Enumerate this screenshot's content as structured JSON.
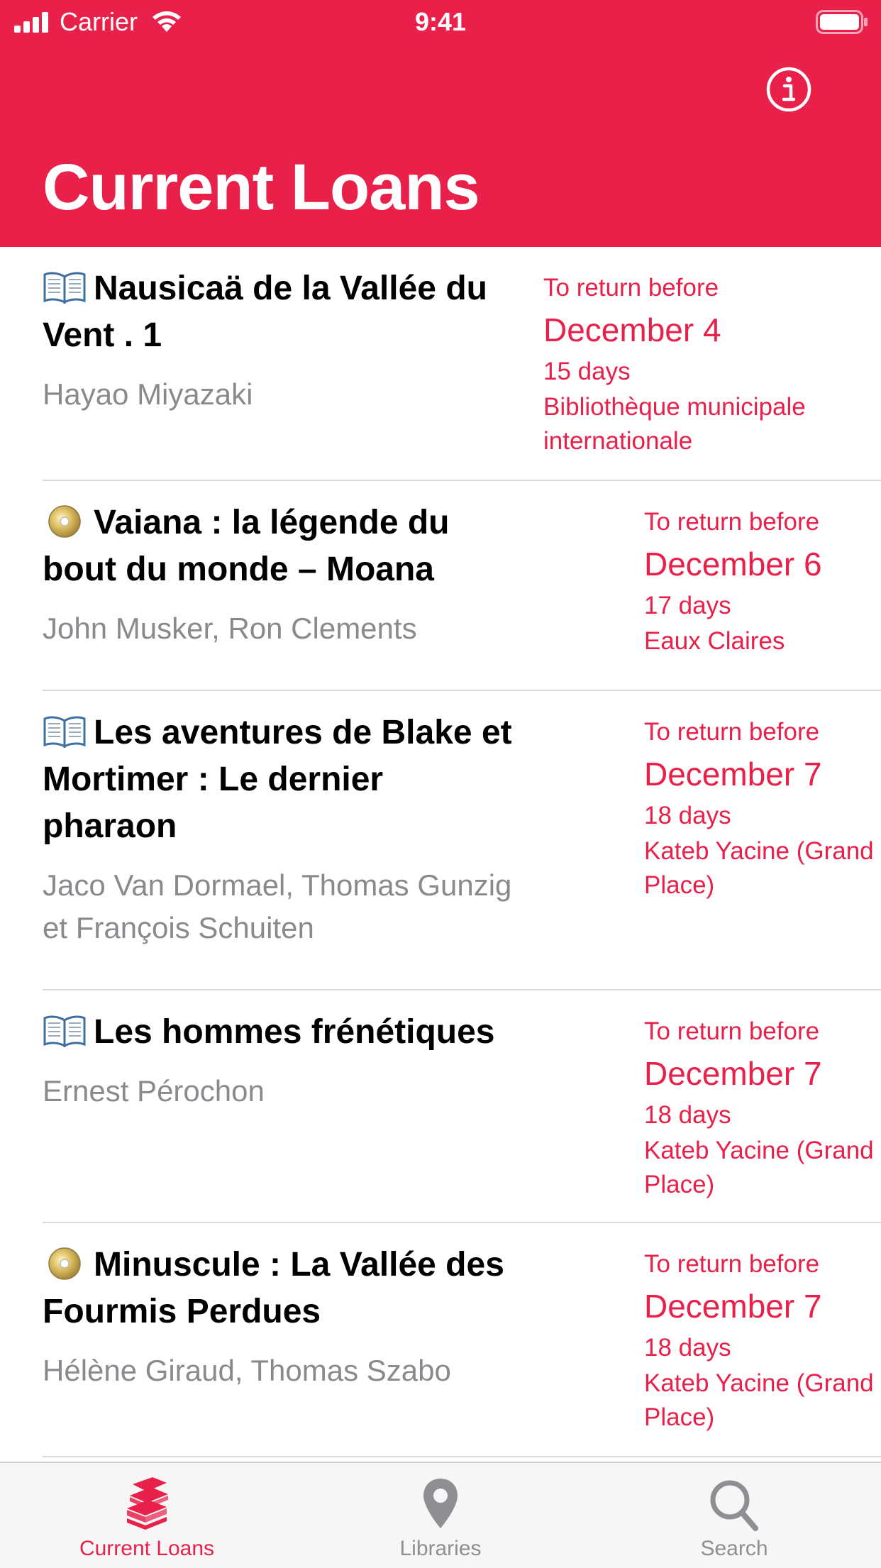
{
  "status_bar": {
    "carrier": "Carrier",
    "time": "9:41"
  },
  "header": {
    "title": "Current Loans",
    "info_icon": "info-circle-icon",
    "background_color": "#e8204a"
  },
  "loans": [
    {
      "media_icon": "book-icon",
      "title": "Nausicaä de la Vallée du Vent . 1",
      "author": "Hayao Miyazaki",
      "due_label": "To return before",
      "due_date": "December 4",
      "days_left": "15 days",
      "library": "Bibliothèque municipale internationale"
    },
    {
      "media_icon": "dvd-icon",
      "title": "Vaiana : la légende du bout du monde – Moana",
      "author": "John Musker, Ron Clements",
      "due_label": "To return before",
      "due_date": "December 6",
      "days_left": "17 days",
      "library": "Eaux Claires"
    },
    {
      "media_icon": "book-icon",
      "title": "Les aventures de Blake et Mortimer : Le dernier pharaon",
      "author": "Jaco Van Dormael, Thomas Gunzig et François Schuiten",
      "due_label": "To return before",
      "due_date": "December 7",
      "days_left": "18 days",
      "library": "Kateb Yacine (Grand Place)"
    },
    {
      "media_icon": "book-icon",
      "title": "Les hommes frénétiques",
      "author": "Ernest Pérochon",
      "due_label": "To return before",
      "due_date": "December 7",
      "days_left": "18 days",
      "library": "Kateb Yacine (Grand Place)"
    },
    {
      "media_icon": "dvd-icon",
      "title": "Minuscule : La Vallée des Fourmis Perdues",
      "author": "Hélène Giraud, Thomas Szabo",
      "due_label": "To return before",
      "due_date": "December 7",
      "days_left": "18 days",
      "library": "Kateb Yacine (Grand Place)"
    }
  ],
  "tab_bar": {
    "tabs": [
      {
        "label": "Current Loans",
        "icon": "books-stack-icon",
        "active": true
      },
      {
        "label": "Libraries",
        "icon": "map-pin-icon",
        "active": false
      },
      {
        "label": "Search",
        "icon": "search-icon",
        "active": false
      }
    ],
    "active_color": "#e8204a",
    "inactive_color": "#8e8e93"
  }
}
